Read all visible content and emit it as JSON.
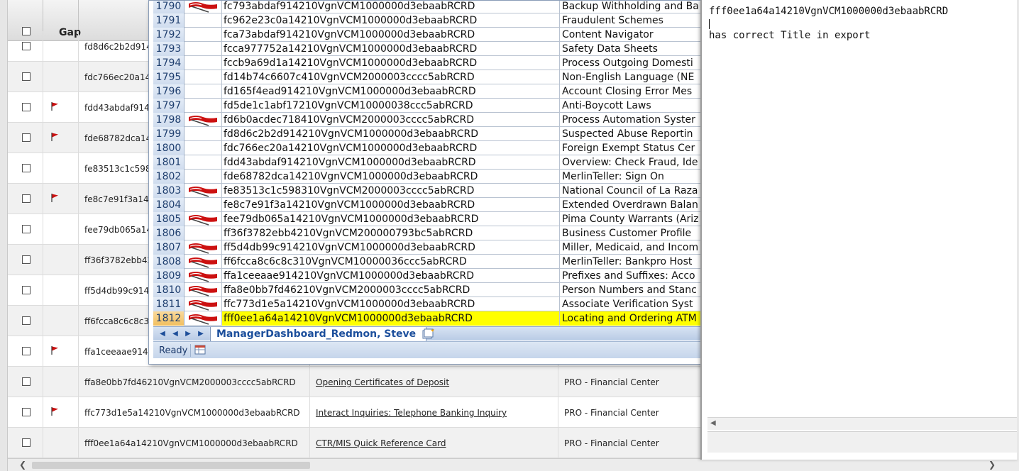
{
  "background_grid": {
    "gap_header": "Gap",
    "rows": [
      {
        "id": "fd8d6c2b2d914",
        "flag": false,
        "title": "",
        "dept": ""
      },
      {
        "id": "fdc766ec20a14",
        "flag": false,
        "title": "",
        "dept": ""
      },
      {
        "id": "fdd43abdaf9142",
        "flag": true,
        "title": "",
        "dept": ""
      },
      {
        "id": "fde68782dca14",
        "flag": true,
        "title": "",
        "dept": ""
      },
      {
        "id": "fe83513c1c598",
        "flag": false,
        "title": "",
        "dept": ""
      },
      {
        "id": "fe8c7e91f3a14",
        "flag": true,
        "title": "",
        "dept": ""
      },
      {
        "id": "fee79db065a14",
        "flag": false,
        "title": "",
        "dept": ""
      },
      {
        "id": "ff36f3782ebb42",
        "flag": false,
        "title": "",
        "dept": ""
      },
      {
        "id": "ff5d4db99c914",
        "flag": false,
        "title": "",
        "dept": ""
      },
      {
        "id": "ff6fcca8c6c8c3",
        "flag": false,
        "title": "",
        "dept": ""
      },
      {
        "id": "ffa1ceeaae9142",
        "flag": true,
        "title": "",
        "dept": ""
      },
      {
        "id": "ffa8e0bb7fd46210VgnVCM2000003cccc5abRCRD",
        "flag": false,
        "title": "Opening Certificates of Deposit",
        "dept": "PRO - Financial Center"
      },
      {
        "id": "ffc773d1e5a14210VgnVCM1000000d3ebaabRCRD",
        "flag": true,
        "title": "Interact Inquiries: Telephone Banking Inquiry",
        "dept": "PRO - Financial Center"
      },
      {
        "id": "fff0ee1a64a14210VgnVCM1000000d3ebaabRCRD",
        "flag": false,
        "title": "CTR/MIS Quick Reference Card",
        "dept": "PRO - Financial Center"
      }
    ]
  },
  "excel": {
    "rows": [
      {
        "num": "1790",
        "flag": true,
        "id": "fc793abdaf914210VgnVCM1000000d3ebaabRCRD",
        "title": "Backup Withholding and Ba",
        "selected": false
      },
      {
        "num": "1791",
        "flag": false,
        "id": "fc962e23c0a14210VgnVCM1000000d3ebaabRCRD",
        "title": "Fraudulent Schemes",
        "selected": false
      },
      {
        "num": "1792",
        "flag": false,
        "id": "fca73abdaf914210VgnVCM1000000d3ebaabRCRD",
        "title": "Content Navigator",
        "selected": false
      },
      {
        "num": "1793",
        "flag": false,
        "id": "fcca977752a14210VgnVCM1000000d3ebaabRCRD",
        "title": "Safety Data Sheets",
        "selected": false
      },
      {
        "num": "1794",
        "flag": false,
        "id": "fccb9a69d1a14210VgnVCM1000000d3ebaabRCRD",
        "title": "Process Outgoing Domesti",
        "selected": false
      },
      {
        "num": "1795",
        "flag": false,
        "id": "fd14b74c6607c410VgnVCM2000003cccc5abRCRD",
        "title": "Non-English Language (NE",
        "selected": false
      },
      {
        "num": "1796",
        "flag": false,
        "id": "fd165f4ead914210VgnVCM1000000d3ebaabRCRD",
        "title": "Account Closing Error Mes",
        "selected": false
      },
      {
        "num": "1797",
        "flag": false,
        "id": "fd5de1c1abf17210VgnVCM10000038ccc5abRCRD",
        "title": "Anti-Boycott Laws",
        "selected": false
      },
      {
        "num": "1798",
        "flag": true,
        "id": "fd6b0acdec718410VgnVCM2000003cccc5abRCRD",
        "title": "Process Automation Syster",
        "selected": false
      },
      {
        "num": "1799",
        "flag": false,
        "id": "fd8d6c2b2d914210VgnVCM1000000d3ebaabRCRD",
        "title": "Suspected Abuse Reportin",
        "selected": false
      },
      {
        "num": "1800",
        "flag": false,
        "id": "fdc766ec20a14210VgnVCM1000000d3ebaabRCRD",
        "title": "Foreign Exempt Status Cer",
        "selected": false
      },
      {
        "num": "1801",
        "flag": false,
        "id": "fdd43abdaf914210VgnVCM1000000d3ebaabRCRD",
        "title": "Overview: Check Fraud, Ide",
        "selected": false
      },
      {
        "num": "1802",
        "flag": false,
        "id": "fde68782dca14210VgnVCM1000000d3ebaabRCRD",
        "title": "MerlinTeller: Sign On",
        "selected": false
      },
      {
        "num": "1803",
        "flag": true,
        "id": "fe83513c1c598310VgnVCM2000003cccc5abRCRD",
        "title": "National Council of La Raza",
        "selected": false
      },
      {
        "num": "1804",
        "flag": false,
        "id": "fe8c7e91f3a14210VgnVCM1000000d3ebaabRCRD",
        "title": "Extended Overdrawn Balan",
        "selected": false
      },
      {
        "num": "1805",
        "flag": true,
        "id": "fee79db065a14210VgnVCM1000000d3ebaabRCRD",
        "title": "Pima County Warrants (Ariz",
        "selected": false
      },
      {
        "num": "1806",
        "flag": false,
        "id": "ff36f3782ebb4210VgnVCM200000793bc5abRCRD",
        "title": "Business Customer Profile",
        "selected": false
      },
      {
        "num": "1807",
        "flag": true,
        "id": "ff5d4db99c914210VgnVCM1000000d3ebaabRCRD",
        "title": "Miller, Medicaid, and Incom",
        "selected": false
      },
      {
        "num": "1808",
        "flag": true,
        "id": "ff6fcca8c6c8c310VgnVCM10000036ccc5abRCRD",
        "title": "MerlinTeller: Bankpro Host",
        "selected": false
      },
      {
        "num": "1809",
        "flag": true,
        "id": "ffa1ceeaae914210VgnVCM1000000d3ebaabRCRD",
        "title": "Prefixes and Suffixes: Acco",
        "selected": false
      },
      {
        "num": "1810",
        "flag": true,
        "id": "ffa8e0bb7fd46210VgnVCM2000003cccc5abRCRD",
        "title": "Person Numbers and Stanc",
        "selected": false
      },
      {
        "num": "1811",
        "flag": true,
        "id": "ffc773d1e5a14210VgnVCM1000000d3ebaabRCRD",
        "title": "Associate Verification Syst",
        "selected": false
      },
      {
        "num": "1812",
        "flag": true,
        "id": "fff0ee1a64a14210VgnVCM1000000d3ebaabRCRD",
        "title": "Locating and Ordering ATM",
        "selected": true
      }
    ],
    "sheet_tab": "ManagerDashboard_Redmon, Steve",
    "status": "Ready"
  },
  "notepad": {
    "line1": "fff0ee1a64a14210VgnVCM1000000d3ebaabRCRD",
    "line2": "has correct Title in export"
  },
  "colors": {
    "selection": "#ffff00",
    "flag_red": "#cc1111",
    "excel_blue": "#1c4f9c"
  }
}
